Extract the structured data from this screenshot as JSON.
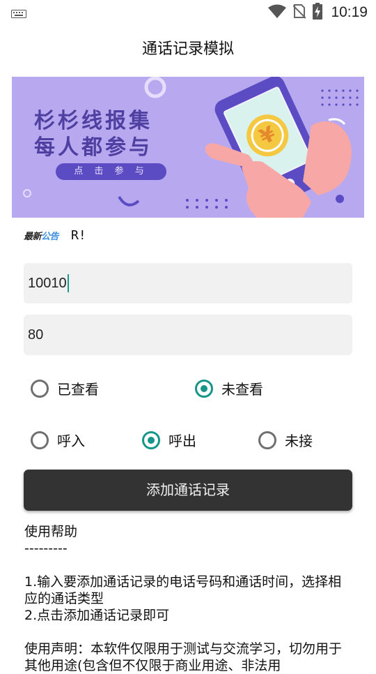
{
  "status_bar": {
    "time": "10:19"
  },
  "app_title": "通话记录模拟",
  "banner": {
    "line1": "杉杉线报集",
    "line2": "每人都参与",
    "button": "点 击 参 与",
    "phone_symbol": "¥",
    "colors": {
      "background": "#b7a8ef",
      "phone": "#5b4cc4",
      "coin": "#f5c842"
    }
  },
  "notice": {
    "logo_part1": "最新",
    "logo_part2": "公告",
    "text": "R!"
  },
  "phone_input": {
    "value": "10010"
  },
  "duration_input": {
    "value": "80"
  },
  "view_status": [
    {
      "label": "已查看",
      "checked": false
    },
    {
      "label": "未查看",
      "checked": true
    }
  ],
  "call_type": [
    {
      "label": "呼入",
      "checked": false
    },
    {
      "label": "呼出",
      "checked": true
    },
    {
      "label": "未接",
      "checked": false
    }
  ],
  "add_button": "添加通话记录",
  "help": {
    "title": "使用帮助",
    "divider": "---------",
    "step1": "1.输入要添加通话记录的电话号码和通话时间，选择相应的通话类型",
    "step2": "2.点击添加通话记录即可",
    "disclaimer": "使用声明：本软件仅限用于测试与交流学习，切勿用于其他用途(包含但不仅限于商业用途、非法用"
  },
  "colors": {
    "accent": "#169688",
    "button": "#333333",
    "field_bg": "#f1f1f1"
  }
}
